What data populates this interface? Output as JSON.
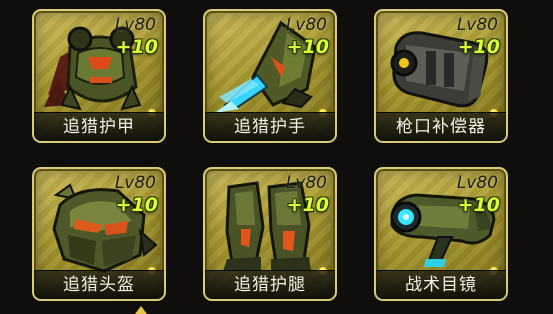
{
  "items": [
    {
      "name": "追猎护甲",
      "level": "Lv80",
      "bonus": "+10",
      "icon": "armor-icon"
    },
    {
      "name": "追猎护手",
      "level": "Lv80",
      "bonus": "+10",
      "icon": "gauntlet-icon"
    },
    {
      "name": "枪口补偿器",
      "level": "Lv80",
      "bonus": "+10",
      "icon": "muzzle-compensator-icon"
    },
    {
      "name": "追猎头盔",
      "level": "Lv80",
      "bonus": "+10",
      "icon": "helmet-icon"
    },
    {
      "name": "追猎护腿",
      "level": "Lv80",
      "bonus": "+10",
      "icon": "leg-guard-icon"
    },
    {
      "name": "战术目镜",
      "level": "Lv80",
      "bonus": "+10",
      "icon": "tactical-scope-icon"
    }
  ],
  "colors": {
    "card_gold": "#a8992f",
    "bonus_green": "#d8ff38",
    "dot_yellow": "#ffd400",
    "label_text": "#f3f1e6"
  }
}
